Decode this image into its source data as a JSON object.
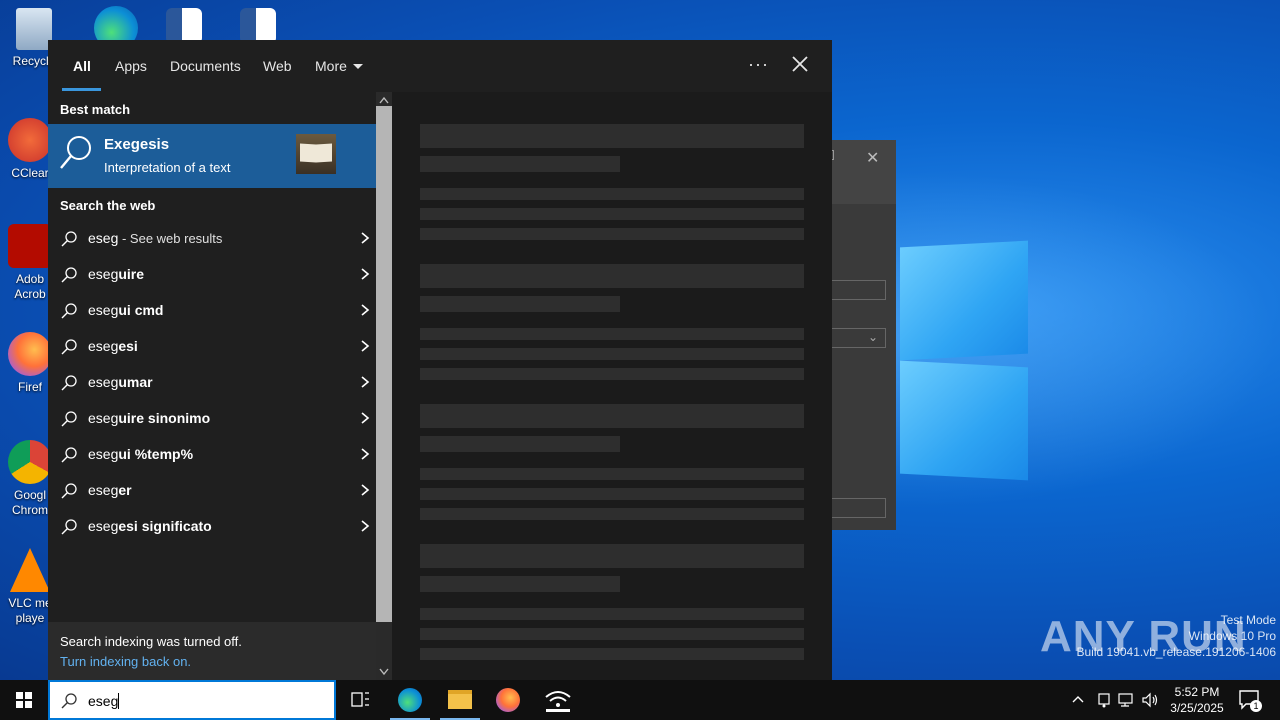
{
  "desktop": {
    "icons": [
      {
        "label": "Recycle"
      },
      {
        "label": "CClear"
      },
      {
        "label": "Adob Acrob"
      },
      {
        "label": "Firef"
      },
      {
        "label": "Googl Chrom"
      },
      {
        "label": "VLC me playe"
      }
    ],
    "watermark": {
      "brand": "ANY RUN",
      "line1": "Test Mode",
      "line2": "Windows 10 Pro",
      "line3": "Build 19041.vb_release.191206-1406"
    }
  },
  "search": {
    "tabs": [
      {
        "label": "All"
      },
      {
        "label": "Apps"
      },
      {
        "label": "Documents"
      },
      {
        "label": "Web"
      },
      {
        "label": "More"
      }
    ],
    "best_match_heading": "Best match",
    "best_match": {
      "title": "Exegesis",
      "subtitle": "Interpretation of a text"
    },
    "web_heading": "Search the web",
    "web_first": {
      "query": "eseg",
      "suffix": " - See web results"
    },
    "web_suggestions": [
      {
        "prefix": "eseg",
        "rest": "uire"
      },
      {
        "prefix": "eseg",
        "rest": "ui cmd"
      },
      {
        "prefix": "eseg",
        "rest": "esi"
      },
      {
        "prefix": "eseg",
        "rest": "umar"
      },
      {
        "prefix": "eseg",
        "rest": "uire sinonimo"
      },
      {
        "prefix": "eseg",
        "rest": "ui %temp%"
      },
      {
        "prefix": "eseg",
        "rest": "er"
      },
      {
        "prefix": "eseg",
        "rest": "esi significato"
      }
    ],
    "indexing": {
      "message": "Search indexing was turned off.",
      "link": "Turn indexing back on."
    }
  },
  "taskbar": {
    "search_value": "eseg",
    "clock_time": "5:52 PM",
    "clock_date": "3/25/2025",
    "notification_count": "1"
  },
  "colors": {
    "accent": "#0078d7",
    "best_match_bg": "#1c5d99",
    "link": "#62b2f0"
  }
}
